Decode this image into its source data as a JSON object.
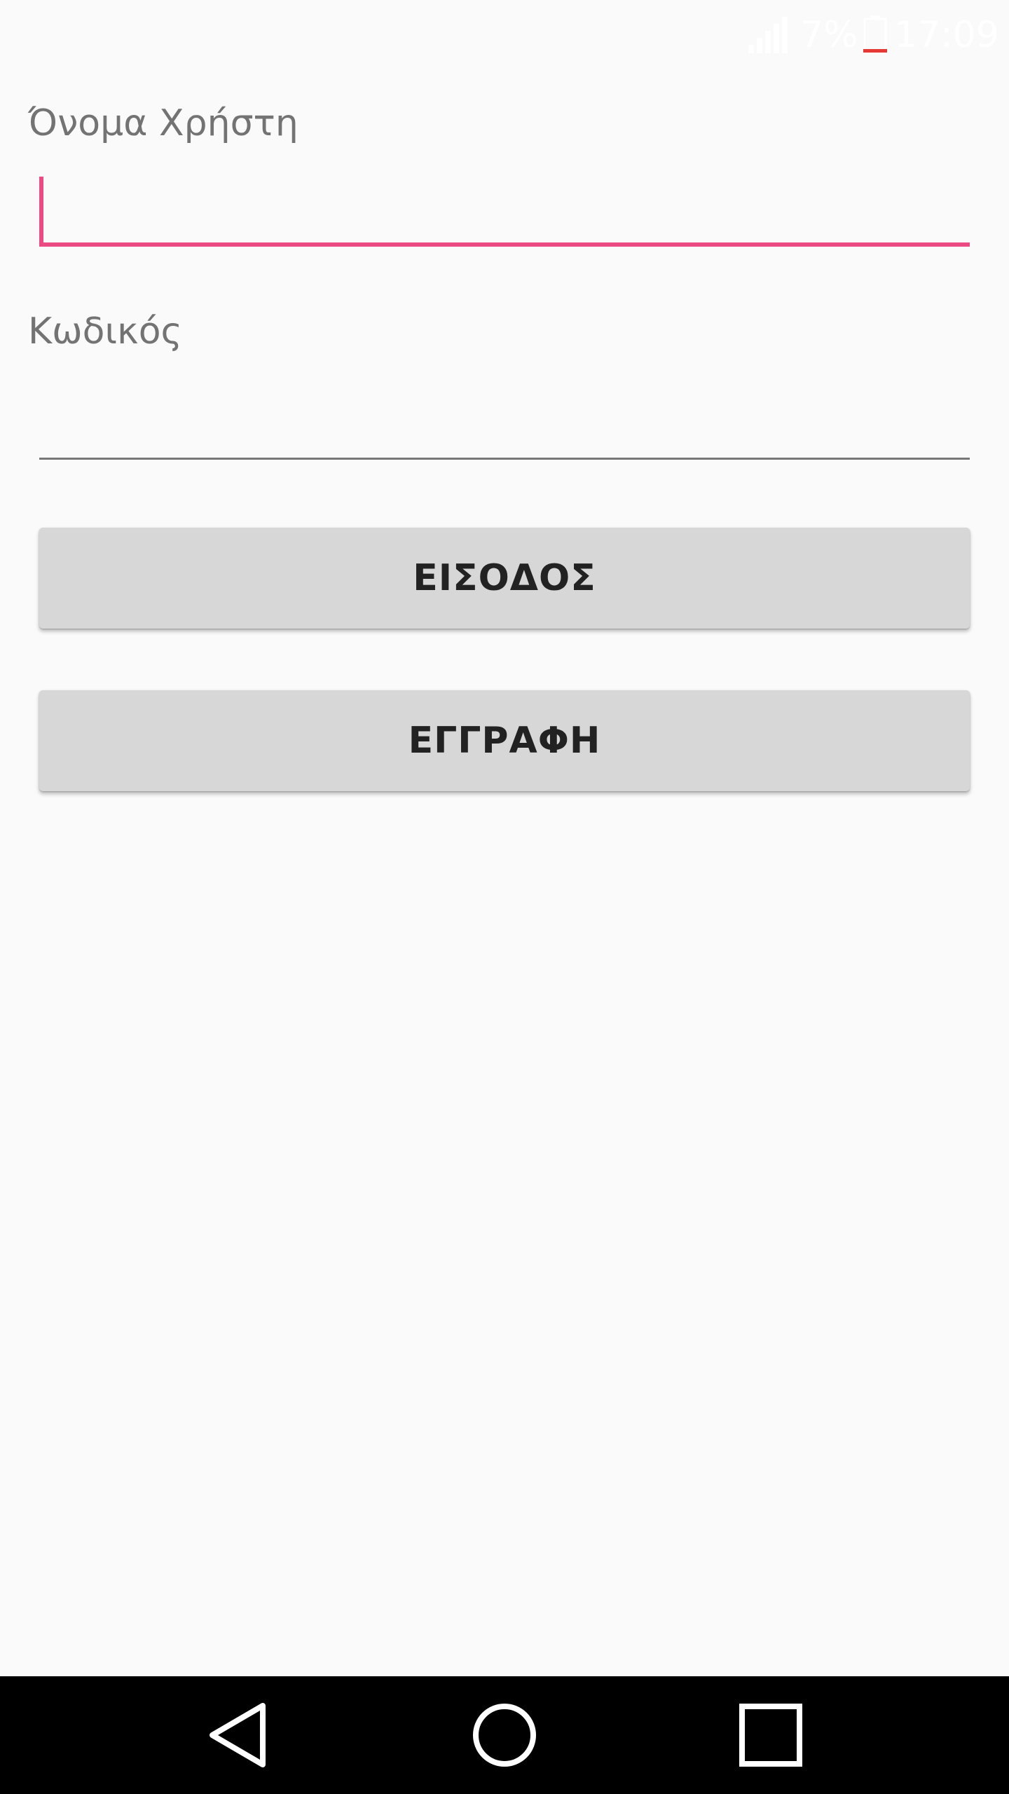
{
  "status_bar": {
    "battery_percent": "7%",
    "time": "17:09",
    "icons": [
      "signal-icon",
      "battery-icon"
    ]
  },
  "form": {
    "username_label": "Όνομα Χρήστη",
    "username_value": "",
    "password_label": "Κωδικός",
    "password_value": "",
    "login_button": "ΕΙΣΟΔΟΣ",
    "register_button": "ΕΓΓΡΑΦΗ"
  },
  "navigation": {
    "icons": [
      "back-icon",
      "home-icon",
      "recent-apps-icon"
    ]
  },
  "colors": {
    "accent": "#ec4a83",
    "background": "#fafafa",
    "button_background": "#d7d7d7",
    "navigation_bar": "#000000"
  }
}
